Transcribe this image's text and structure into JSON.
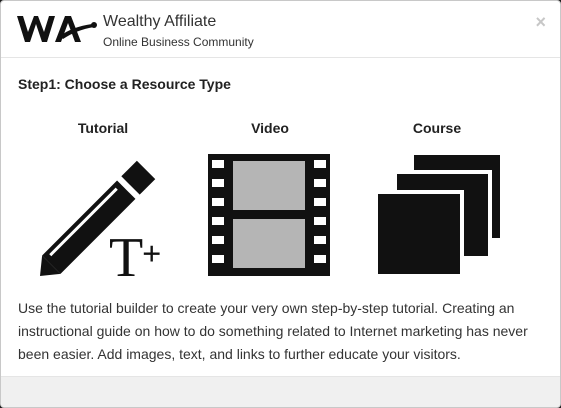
{
  "header": {
    "brand_title": "Wealthy Affiliate",
    "brand_subtitle": "Online Business Community",
    "close_label": "×"
  },
  "step": {
    "title": "Step1: Choose a Resource Type"
  },
  "resource_types": [
    {
      "label": "Tutorial",
      "icon": "pencil-text-icon"
    },
    {
      "label": "Video",
      "icon": "film-strip-icon"
    },
    {
      "label": "Course",
      "icon": "stacked-pages-icon"
    }
  ],
  "description": "Use the tutorial builder to create your very own step-by-step tutorial. Creating an instructional guide on how to do something related to Internet marketing has never been easier. Add images, text, and links to further educate your visitors.",
  "colors": {
    "icon": "#111111",
    "film_frame": "#b5b5b5",
    "close": "#c7c7c7"
  }
}
